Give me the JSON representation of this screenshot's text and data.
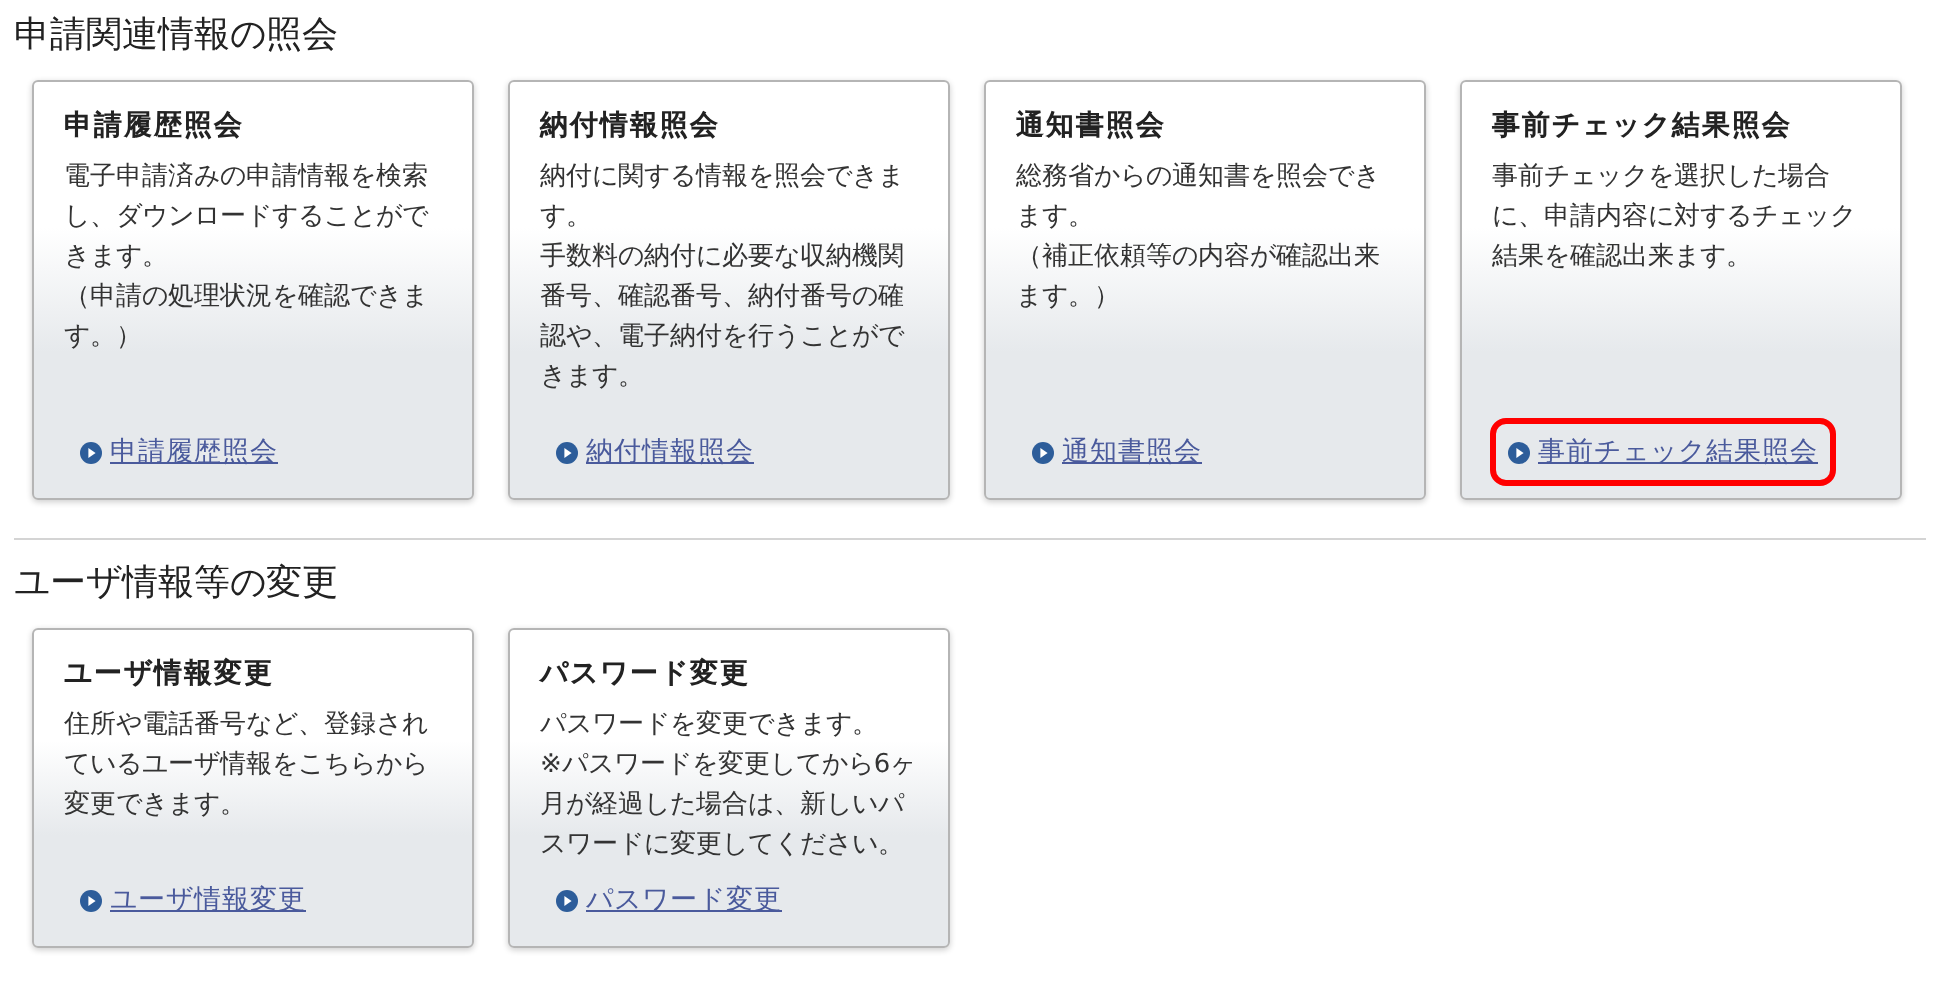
{
  "sections": [
    {
      "heading": "申請関連情報の照会",
      "cards": [
        {
          "title": "申請履歴照会",
          "paragraphs": [
            "電子申請済みの申請情報を検索し、ダウンロードすることができます。",
            "（申請の処理状況を確認できます。）"
          ],
          "link": {
            "label": "申請履歴照会",
            "highlighted": false
          }
        },
        {
          "title": "納付情報照会",
          "paragraphs": [
            "納付に関する情報を照会できます。",
            "手数料の納付に必要な収納機関番号、確認番号、納付番号の確認や、電子納付を行うことができます。"
          ],
          "link": {
            "label": "納付情報照会",
            "highlighted": false
          }
        },
        {
          "title": "通知書照会",
          "paragraphs": [
            "総務省からの通知書を照会できます。",
            "（補正依頼等の内容が確認出来ます。）"
          ],
          "link": {
            "label": "通知書照会",
            "highlighted": false
          }
        },
        {
          "title": "事前チェック結果照会",
          "paragraphs": [
            "事前チェックを選択した場合に、申請内容に対するチェック結果を確認出来ます。"
          ],
          "link": {
            "label": "事前チェック結果照会",
            "highlighted": true
          }
        }
      ]
    },
    {
      "heading": "ユーザ情報等の変更",
      "cards": [
        {
          "title": "ユーザ情報変更",
          "paragraphs": [
            "住所や電話番号など、登録されているユーザ情報をこちらから変更できます。"
          ],
          "link": {
            "label": "ユーザ情報変更",
            "highlighted": false
          }
        },
        {
          "title": "パスワード変更",
          "paragraphs": [
            "パスワードを変更できます。",
            "※パスワードを変更してから6ヶ月が経過した場合は、新しいパスワードに変更してください。"
          ],
          "link": {
            "label": "パスワード変更",
            "highlighted": false
          }
        }
      ]
    }
  ]
}
